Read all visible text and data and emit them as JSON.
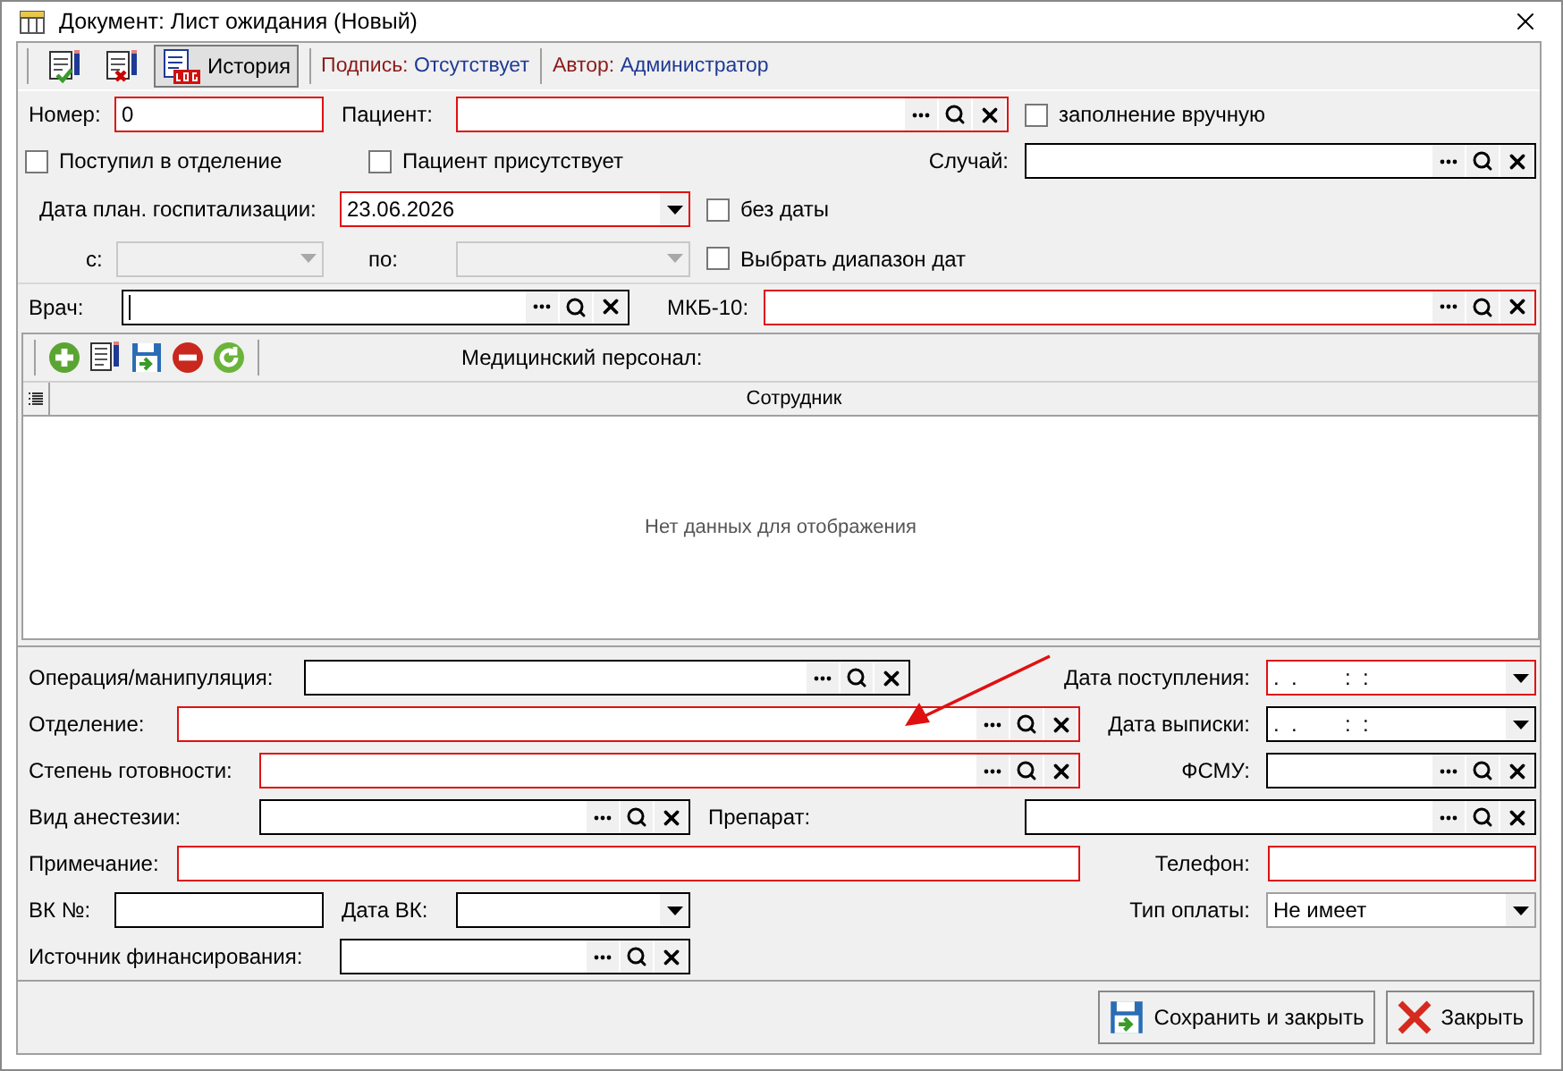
{
  "window": {
    "title": "Документ: Лист ожидания (Новый)"
  },
  "toolbar": {
    "history": {
      "label": "История",
      "pressed": true
    },
    "signature": {
      "label": "Подпись:",
      "value": "Отсутствует"
    },
    "author": {
      "label": "Автор:",
      "value": "Администратор"
    }
  },
  "header": {
    "number": {
      "label": "Номер:",
      "kind": "text",
      "required": true,
      "value": "0"
    },
    "patient": {
      "label": "Пациент:",
      "kind": "lookup",
      "required": true
    },
    "manual_fill": {
      "label": "заполнение вручную",
      "checked": false
    },
    "admitted": {
      "label": "Поступил в отделение",
      "checked": false
    },
    "patient_present": {
      "label": "Пациент присутствует",
      "checked": false
    },
    "case": {
      "label": "Случай:",
      "kind": "lookup",
      "required": false
    },
    "planned_date": {
      "label": "Дата план. госпитализации:",
      "kind": "combo",
      "required": true,
      "value": "23.06.2026"
    },
    "no_date": {
      "label": "без даты",
      "checked": false
    },
    "date_from": {
      "label": "с:",
      "kind": "combo",
      "required": false,
      "disabled": true
    },
    "date_to": {
      "label": "по:",
      "kind": "combo",
      "required": false,
      "disabled": true
    },
    "date_range": {
      "label": "Выбрать диапазон дат",
      "checked": false
    },
    "doctor": {
      "label": "Врач:",
      "kind": "lookup",
      "required": false,
      "focused": true
    },
    "mkb": {
      "label": "МКБ-10:",
      "kind": "lookup",
      "required": true
    }
  },
  "staff": {
    "title": "Медицинский персонал:",
    "columns": [
      "Сотрудник"
    ],
    "empty_text": "Нет данных для отображения"
  },
  "details": {
    "operation": {
      "label": "Операция/манипуляция:",
      "kind": "lookup",
      "required": false
    },
    "admission_date": {
      "label": "Дата поступления:",
      "kind": "datetime",
      "required": true,
      "value": ".  .        :  :"
    },
    "department": {
      "label": "Отделение:",
      "kind": "lookup",
      "required": true
    },
    "discharge_date": {
      "label": "Дата выписки:",
      "kind": "datetime",
      "required": false,
      "value": ".  .        :  :"
    },
    "readiness": {
      "label": "Степень готовности:",
      "kind": "lookup",
      "required": true
    },
    "fsmu": {
      "label": "ФСМУ:",
      "kind": "lookup",
      "required": false
    },
    "anesthesia": {
      "label": "Вид анестезии:",
      "kind": "lookup",
      "required": false
    },
    "drug": {
      "label": "Препарат:",
      "kind": "lookup",
      "required": false
    },
    "note": {
      "label": "Примечание:",
      "kind": "text",
      "required": true
    },
    "phone": {
      "label": "Телефон:",
      "kind": "text",
      "required": true
    },
    "vk_number": {
      "label": "ВК №:",
      "kind": "text",
      "required": false
    },
    "vk_date": {
      "label": "Дата ВК:",
      "kind": "combo",
      "required": false
    },
    "payment_type": {
      "label": "Тип оплаты:",
      "kind": "select",
      "required": false,
      "value": "Не имеет"
    },
    "funding": {
      "label": "Источник финансирования:",
      "kind": "lookup",
      "required": false
    }
  },
  "buttons": [
    {
      "kind": "save",
      "label": "Сохранить и закрыть"
    },
    {
      "kind": "close",
      "label": "Закрыть"
    }
  ]
}
